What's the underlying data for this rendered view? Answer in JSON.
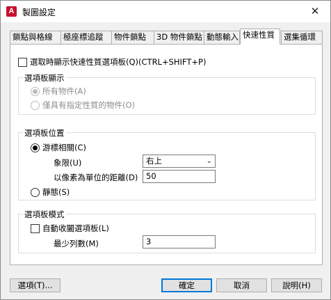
{
  "window": {
    "title": "製圖設定",
    "app_icon_letter": "A",
    "close_glyph": "✕"
  },
  "tabs": [
    {
      "label": "鎖點與格線",
      "active": false
    },
    {
      "label": "極座標追蹤",
      "active": false
    },
    {
      "label": "物件鎖點",
      "active": false
    },
    {
      "label": "3D 物件鎖點",
      "active": false
    },
    {
      "label": "動態輸入",
      "active": false
    },
    {
      "label": "快速性質",
      "active": true
    },
    {
      "label": "選集循環",
      "active": false
    }
  ],
  "quick_properties": {
    "show_on_select_label": "選取時顯示快速性質選項板(Q)(CTRL+SHIFT+P)",
    "show_on_select_checked": false
  },
  "palette_display": {
    "title": "選項板顯示",
    "options": [
      {
        "label": "所有物件(A)",
        "selected": true
      },
      {
        "label": "僅具有指定性質的物件(O)",
        "selected": false
      }
    ]
  },
  "palette_location": {
    "title": "選項板位置",
    "cursor_dependent_label": "游標相關(C)",
    "cursor_dependent_selected": true,
    "quadrant_label": "象限(U)",
    "quadrant_value": "右上",
    "distance_label": "以像素為單位的距離(D)",
    "distance_value": "50",
    "static_label": "靜態(S)",
    "static_selected": false
  },
  "palette_behavior": {
    "title": "選項板模式",
    "auto_collapse_label": "自動收闔選項板(L)",
    "auto_collapse_checked": false,
    "min_rows_label": "最少列數(M)",
    "min_rows_value": "3"
  },
  "buttons": {
    "options": "選項(T)...",
    "ok": "確定",
    "cancel": "取消",
    "help": "說明(H)"
  }
}
